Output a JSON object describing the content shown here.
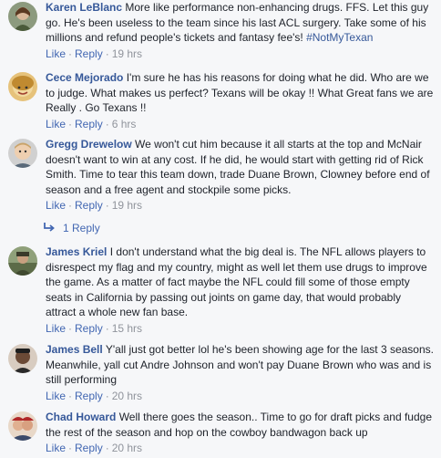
{
  "comments": [
    {
      "name": "Karen LeBlanc",
      "text": "More like performance non-enhancing drugs. FFS. Let this guy go. He's been useless to the team since his last ACL surgery. Take some of his millions and refund people's tickets and fantasy fee's! ",
      "hashtag": "#NotMyTexan",
      "like": "Like",
      "reply": "Reply",
      "time": "19 hrs",
      "avatar_color": "#7a8a6a"
    },
    {
      "name": "Cece Mejorado",
      "text": "I'm sure he has his reasons for doing what he did. Who are we to judge. What makes us perfect? Texans will be okay !! What Great fans we are Really . Go Texans !!",
      "like": "Like",
      "reply": "Reply",
      "time": "6 hrs",
      "avatar_color": "#c79a3c"
    },
    {
      "name": "Gregg Drewelow",
      "text": "We won't cut him because it all starts at the top and McNair doesn't want to win at any cost. If he did, he would start with getting rid of Rick Smith. Time to tear this team down, trade Duane Brown, Clowney before end of season and a free agent and stockpile some picks.",
      "like": "Like",
      "reply": "Reply",
      "time": "19 hrs",
      "replies_label": "1 Reply",
      "avatar_color": "#a0a0a0"
    },
    {
      "name": "James Kriel",
      "text": "I don't understand what the big deal is. The NFL allows players to disrespect my flag and my country, might as well let them use drugs to improve the game. As a matter of fact maybe the NFL could fill some of those empty seats in California by passing out joints on game day, that would probably attract a whole new fan base.",
      "like": "Like",
      "reply": "Reply",
      "time": "15 hrs",
      "avatar_color": "#6b7a5a"
    },
    {
      "name": "James Bell",
      "text": "Y'all just got better lol he's been showing age for the last 3 seasons. Meanwhile, yall cut Andre Johnson and won't pay Duane Brown who was and is still performing",
      "like": "Like",
      "reply": "Reply",
      "time": "20 hrs",
      "avatar_color": "#5a4a40"
    },
    {
      "name": "Chad Howard",
      "text": "Well there goes the season.. Time to go for draft picks and fudge the rest of the season and hop on the cowboy bandwagon back up",
      "like": "Like",
      "reply": "Reply",
      "time": "20 hrs",
      "avatar_color": "#b03030"
    }
  ]
}
